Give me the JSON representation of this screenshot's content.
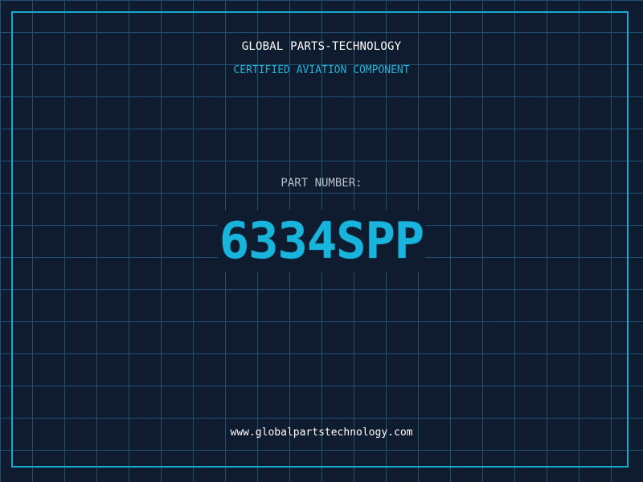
{
  "header": {
    "company_name": "GLOBAL PARTS-TECHNOLOGY",
    "subtitle": "CERTIFIED AVIATION COMPONENT"
  },
  "part": {
    "label": "PART NUMBER:",
    "number": "6334SPP"
  },
  "footer": {
    "website": "www.globalpartstechnology.com"
  },
  "colors": {
    "background": "#0f1b2e",
    "grid_line": "#1f5270",
    "frame": "#1aa8cf",
    "accent": "#19b4dc",
    "title_text": "#ffffff",
    "label_text": "#b9c1cc"
  }
}
